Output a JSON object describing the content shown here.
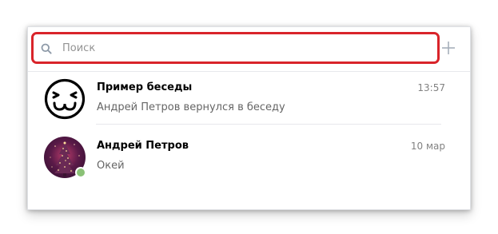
{
  "search": {
    "placeholder": "Поиск",
    "icon": "search-icon",
    "highlight_color": "#d9242a"
  },
  "toolbar": {
    "add_icon": "plus-icon"
  },
  "conversations": [
    {
      "title": "Пример беседы",
      "time": "13:57",
      "preview": "Андрей Петров вернулся в беседу",
      "avatar": "smiley-face-icon"
    },
    {
      "title": "Андрей Петров",
      "time": "10 мар",
      "preview": "Окей",
      "avatar": "christmas-tree-photo",
      "online": true,
      "online_color": "#8ac176"
    }
  ]
}
